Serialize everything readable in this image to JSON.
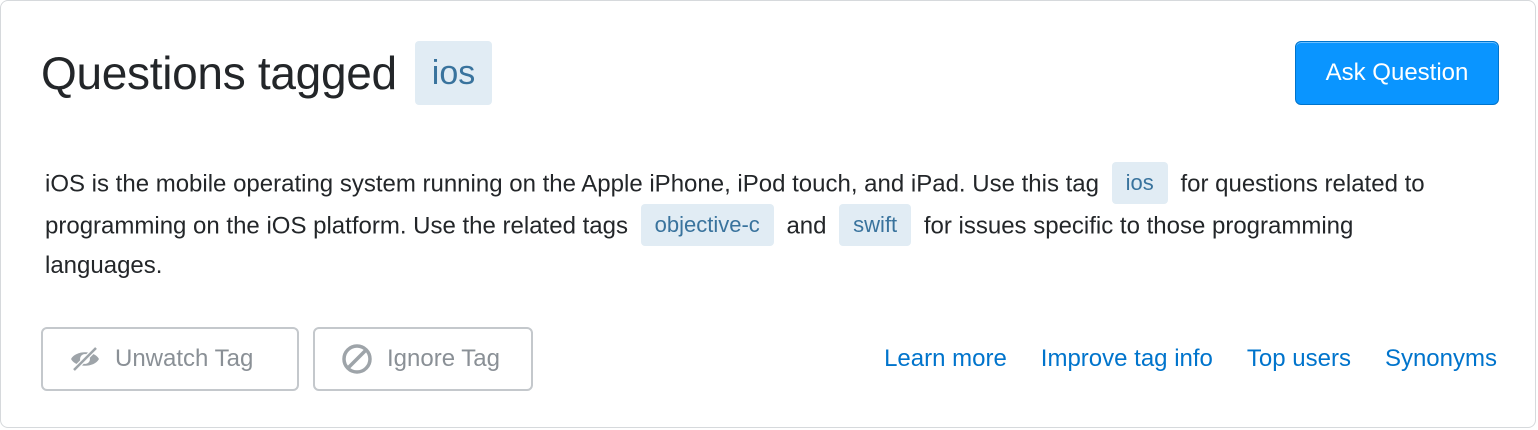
{
  "header": {
    "title": "Questions tagged",
    "tag": "ios"
  },
  "ask_button_label": "Ask Question",
  "description": {
    "part1": "iOS is the mobile operating system running on the Apple iPhone, iPod touch, and iPad. Use this tag",
    "tag1": "ios",
    "part2": "for questions related to programming on the iOS platform. Use the related tags",
    "tag2": "objective-c",
    "part3": "and",
    "tag3": "swift",
    "part4": "for issues specific to those programming languages."
  },
  "actions": {
    "unwatch_label": "Unwatch Tag",
    "unwatch_icon": "eye-off-icon",
    "ignore_label": "Ignore Tag",
    "ignore_icon": "block-icon"
  },
  "links": {
    "learn_more": "Learn more",
    "improve": "Improve tag info",
    "top_users": "Top users",
    "synonyms": "Synonyms"
  },
  "colors": {
    "primary_button": "#0a95ff",
    "tag_bg": "#e1ecf4",
    "tag_text": "#39739d",
    "link": "#0074cc"
  }
}
